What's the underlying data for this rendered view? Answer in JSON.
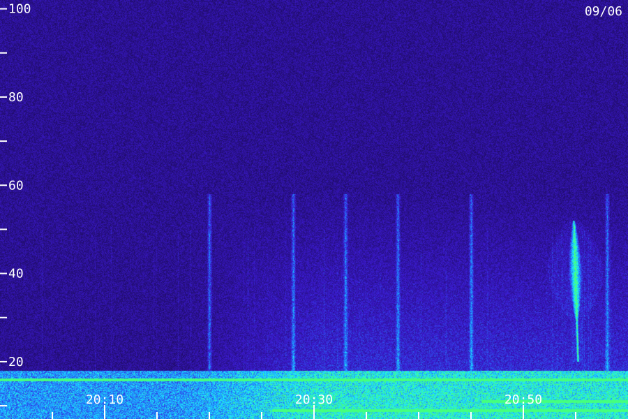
{
  "chart_data": {
    "type": "heatmap",
    "date_label": "09/06",
    "y_tick_labels": [
      "100",
      "80",
      "60",
      "40",
      "20"
    ],
    "y_ticks": [
      100,
      80,
      60,
      40,
      20
    ],
    "y_minor_ticks": [
      90,
      70,
      50,
      30,
      10
    ],
    "ylim": [
      7,
      102
    ],
    "x_tick_labels": [
      "20:10",
      "20:30",
      "20:50"
    ],
    "x_ticks_minutes": [
      10,
      30,
      50
    ],
    "x_minor_tick_step_minutes": 5,
    "xlim_minutes": [
      0,
      60
    ],
    "features": {
      "low_band_top": 18,
      "bright_burst": {
        "time": "20:55",
        "freq_range": [
          20,
          52
        ]
      },
      "vertical_streak_times": [
        "20:20",
        "20:28",
        "20:33",
        "20:38",
        "20:45",
        "20:58"
      ],
      "horizontal_lines": [
        {
          "freq": 9,
          "time_range": [
            "20:26",
            "21:00"
          ]
        },
        {
          "freq": 11,
          "time_range": [
            "20:46",
            "21:00"
          ]
        },
        {
          "freq": 16,
          "time_range": [
            "20:00",
            "21:00"
          ]
        }
      ]
    },
    "colors": {
      "background": "#1e0a55",
      "noise": "#3a1ec8",
      "emission": "#2a6cff",
      "bright": "#22e0ff",
      "peak": "#3cff80"
    }
  }
}
